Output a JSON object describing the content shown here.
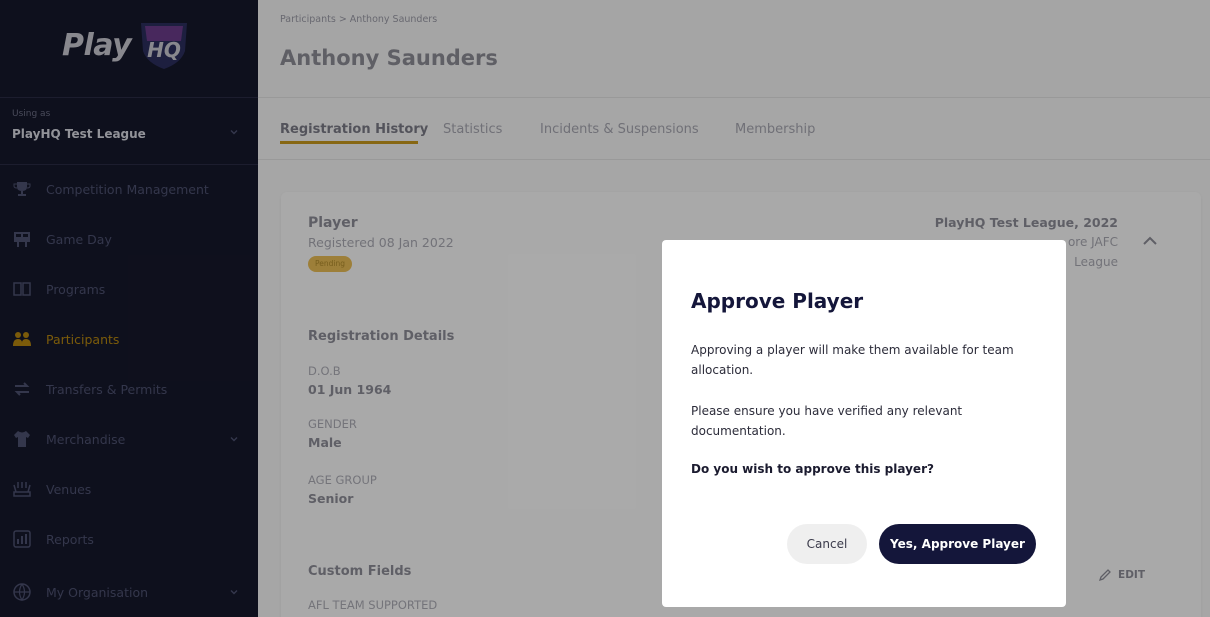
{
  "app": {
    "logo_text": "Play",
    "logo_shield_text": "HQ"
  },
  "sidebar": {
    "using_as_label": "Using as",
    "org_name": "PlayHQ Test League",
    "items": [
      {
        "label": "Competition Management",
        "icon": "trophy-icon"
      },
      {
        "label": "Game Day",
        "icon": "scoreboard-icon"
      },
      {
        "label": "Programs",
        "icon": "book-icon"
      },
      {
        "label": "Participants",
        "icon": "participants-icon",
        "active": true
      },
      {
        "label": "Transfers & Permits",
        "icon": "transfer-icon"
      },
      {
        "label": "Merchandise",
        "icon": "merchandise-icon"
      },
      {
        "label": "Venues",
        "icon": "venue-icon"
      },
      {
        "label": "Reports",
        "icon": "reports-icon"
      },
      {
        "label": "My Organisation",
        "icon": "globe-icon"
      }
    ]
  },
  "header": {
    "breadcrumb": "Participants > Anthony Saunders",
    "title": "Anthony Saunders"
  },
  "tabs": [
    {
      "label": "Registration History",
      "active": true
    },
    {
      "label": "Statistics"
    },
    {
      "label": "Incidents & Suspensions"
    },
    {
      "label": "Membership"
    }
  ],
  "registration": {
    "role": "Player",
    "registered": "Registered 08 Jan 2022",
    "status": "Pending",
    "league": "PlayHQ Test League, 2022",
    "club": "ore JAFC",
    "sub_league": "League",
    "details_title": "Registration Details",
    "fields": [
      {
        "label": "D.O.B",
        "value": "01 Jun 1964"
      },
      {
        "label": "GENDER",
        "value": "Male"
      },
      {
        "label": "AGE GROUP",
        "value": "Senior"
      }
    ],
    "custom_title": "Custom Fields",
    "custom_field_label": "AFL TEAM SUPPORTED",
    "edit_label": "EDIT"
  },
  "modal": {
    "title": "Approve Player",
    "p1": "Approving a player will make them available for team allocation.",
    "p2": "Please ensure you have verified any relevant documentation.",
    "question": "Do you wish to approve this player?",
    "cancel": "Cancel",
    "confirm": "Yes, Approve Player"
  },
  "colors": {
    "accent": "#c7981c",
    "sidebar_bg": "#16182b",
    "primary_button": "#14163a"
  }
}
